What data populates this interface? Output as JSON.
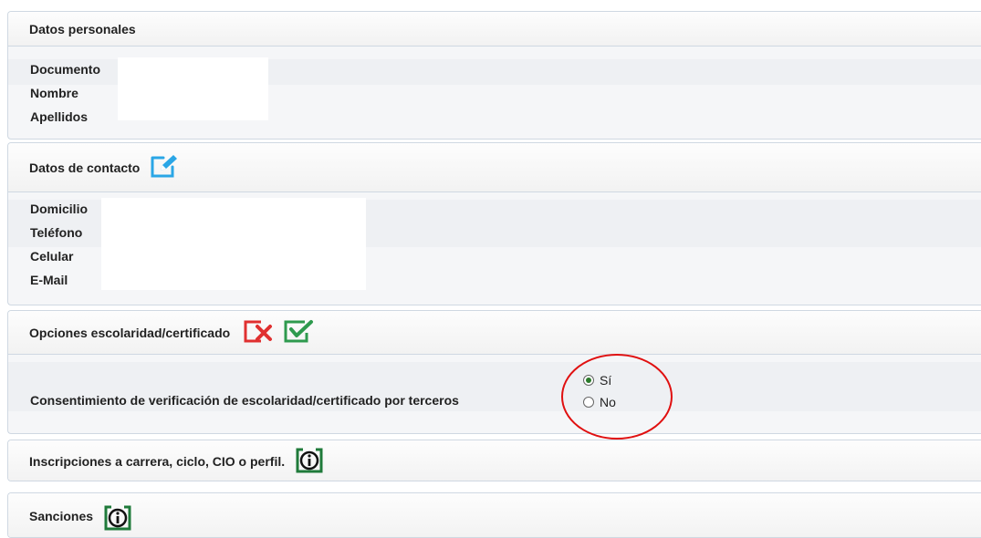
{
  "personal": {
    "title": "Datos personales",
    "fields": [
      "Documento",
      "Nombre",
      "Apellidos"
    ]
  },
  "contact": {
    "title": "Datos de contacto",
    "edit_icon": "edit-icon",
    "fields": [
      "Domicilio",
      "Teléfono",
      "Celular",
      "E-Mail"
    ]
  },
  "schooling": {
    "title": "Opciones escolaridad/certificado",
    "consent_label": "Consentimiento de verificación de escolaridad/certificado por terceros",
    "options": [
      {
        "label": "Sí",
        "selected": true
      },
      {
        "label": "No",
        "selected": false
      }
    ]
  },
  "enrollments": {
    "title": "Inscripciones a carrera, ciclo, CIO o perfil."
  },
  "sanctions": {
    "title": "Sanciones"
  },
  "colors": {
    "blue_icon": "#2aa6e6",
    "red_icon": "#e03030",
    "green_icon": "#2e9a4e",
    "info_icon": "#1f7a3a",
    "annotation_circle": "#e01010"
  }
}
